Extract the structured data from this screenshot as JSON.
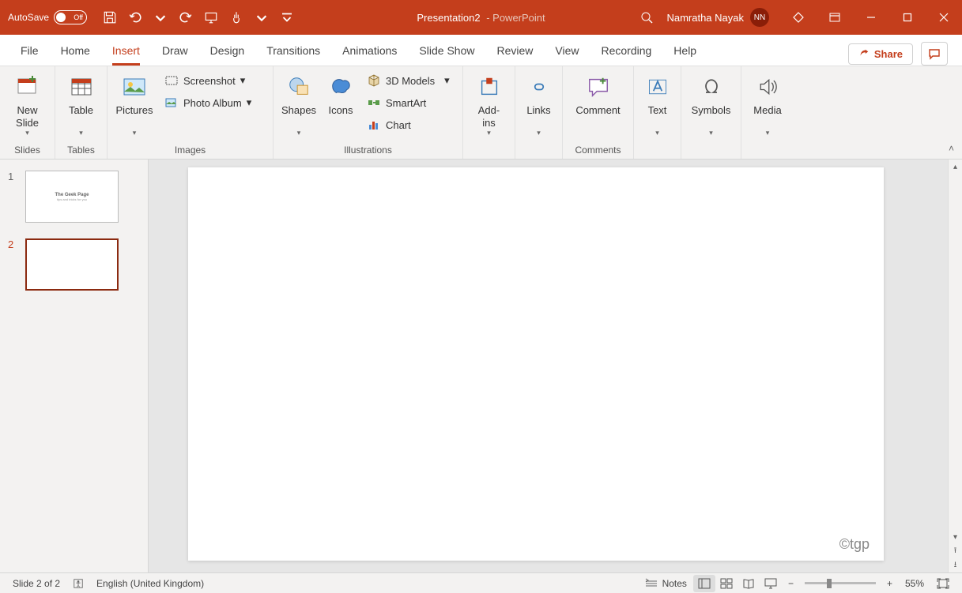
{
  "titlebar": {
    "autosave_label": "AutoSave",
    "autosave_state": "Off",
    "doc_name": "Presentation2",
    "separator": " - ",
    "app_name": "PowerPoint",
    "user_name": "Namratha Nayak",
    "user_initials": "NN"
  },
  "tabs": {
    "file": "File",
    "home": "Home",
    "insert": "Insert",
    "draw": "Draw",
    "design": "Design",
    "transitions": "Transitions",
    "animations": "Animations",
    "slideshow": "Slide Show",
    "review": "Review",
    "view": "View",
    "recording": "Recording",
    "help": "Help",
    "share": "Share"
  },
  "ribbon": {
    "groups": {
      "slides": {
        "label": "Slides",
        "new_slide": "New\nSlide"
      },
      "tables": {
        "label": "Tables",
        "table": "Table"
      },
      "images": {
        "label": "Images",
        "pictures": "Pictures",
        "screenshot": "Screenshot",
        "photo_album": "Photo Album"
      },
      "illustrations": {
        "label": "Illustrations",
        "shapes": "Shapes",
        "icons": "Icons",
        "models3d": "3D Models",
        "smartart": "SmartArt",
        "chart": "Chart"
      },
      "addins": {
        "label": "",
        "addins": "Add-\nins"
      },
      "links": {
        "label": "",
        "links": "Links"
      },
      "comments": {
        "label": "Comments",
        "comment": "Comment"
      },
      "text": {
        "label": "",
        "text": "Text"
      },
      "symbols": {
        "label": "",
        "symbols": "Symbols"
      },
      "media": {
        "label": "",
        "media": "Media"
      }
    }
  },
  "thumbnails": {
    "items": [
      {
        "num": "1",
        "title": "The Geek Page",
        "subtitle": "tips and tricks for you"
      },
      {
        "num": "2",
        "title": "",
        "subtitle": ""
      }
    ]
  },
  "watermark": "©tgp",
  "statusbar": {
    "slide_info": "Slide 2 of 2",
    "language": "English (United Kingdom)",
    "notes": "Notes",
    "zoom": "55%"
  }
}
